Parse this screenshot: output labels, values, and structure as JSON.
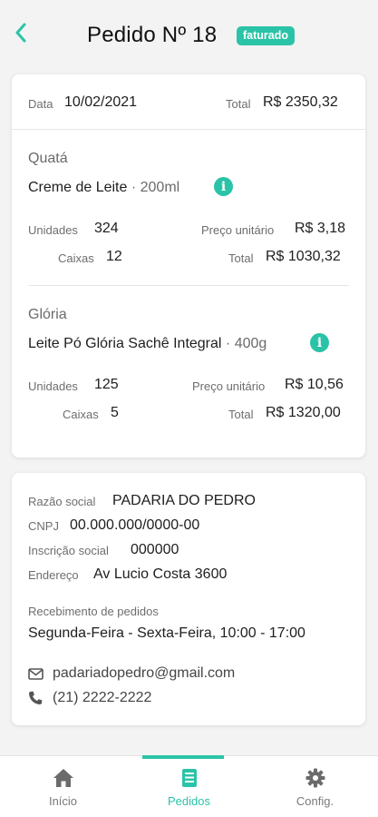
{
  "header": {
    "title": "Pedido Nº 18",
    "status": "faturado"
  },
  "order": {
    "date_label": "Data",
    "date": "10/02/2021",
    "total_label": "Total",
    "total": "R$ 2350,32",
    "items": [
      {
        "brand": "Quatá",
        "product": "Creme de Leite",
        "size": "· 200ml",
        "units_label": "Unidades",
        "units": "324",
        "unit_price_label": "Preço unitário",
        "unit_price": "R$ 3,18",
        "boxes_label": "Caixas",
        "boxes": "12",
        "total_label": "Total",
        "total": "R$ 1030,32"
      },
      {
        "brand": "Glória",
        "product": "Leite Pó Glória Sachê Integral",
        "size": "· 400g",
        "units_label": "Unidades",
        "units": "125",
        "unit_price_label": "Preço unitário",
        "unit_price": "R$ 10,56",
        "boxes_label": "Caixas",
        "boxes": "5",
        "total_label": "Total",
        "total": "R$ 1320,00"
      }
    ]
  },
  "client": {
    "company_label": "Razão social",
    "company": "PADARIA DO PEDRO",
    "cnpj_label": "CNPJ",
    "cnpj": "00.000.000/0000-00",
    "registration_label": "Inscrição social",
    "registration": "000000",
    "address_label": "Endereço",
    "address": "Av Lucio Costa 3600",
    "receiving_label": "Recebimento de pedidos",
    "receiving": "Segunda-Feira - Sexta-Feira, 10:00 - 17:00",
    "email": "padariadopedro@gmail.com",
    "phone": "(21) 2222-2222"
  },
  "nav": {
    "items": [
      {
        "label": "Início",
        "icon": "home-icon"
      },
      {
        "label": "Pedidos",
        "icon": "document-icon",
        "active": true
      },
      {
        "label": "Config.",
        "icon": "gear-icon"
      }
    ]
  },
  "colors": {
    "accent": "#2bc3a7",
    "background": "#f3f3f3"
  }
}
